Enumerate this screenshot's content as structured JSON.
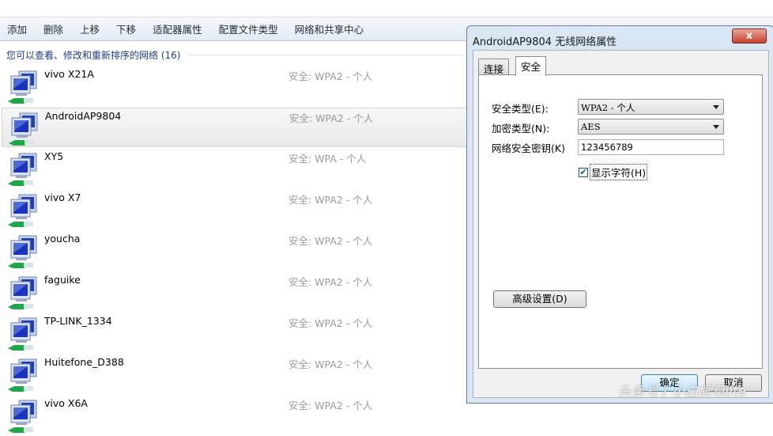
{
  "toolbar": {
    "items": [
      "添加",
      "删除",
      "上移",
      "下移",
      "适配器属性",
      "配置文件类型",
      "网络和共享中心"
    ]
  },
  "group_header": "您可以查看、修改和重新排序的网络 (16)",
  "networks": [
    {
      "name": "vivo X21A",
      "security": "安全: WPA2 - 个人"
    },
    {
      "name": "AndroidAP9804",
      "security": "安全: WPA2 - 个人",
      "selected": true
    },
    {
      "name": "XY5",
      "security": "安全: WPA - 个人"
    },
    {
      "name": "vivo X7",
      "security": "安全: WPA2 - 个人"
    },
    {
      "name": "youcha",
      "security": "安全: WPA2 - 个人"
    },
    {
      "name": "faguike",
      "security": "安全: WPA2 - 个人"
    },
    {
      "name": "TP-LINK_1334",
      "security": "安全: WPA2 - 个人"
    },
    {
      "name": "Huitefone_D388",
      "security": "安全: WPA2 - 个人"
    },
    {
      "name": "vivo X6A",
      "security": "安全: WPA2 - 个人"
    }
  ],
  "dialog": {
    "title": "AndroidAP9804 无线网络属性",
    "close": "x",
    "tabs": [
      "连接",
      "安全"
    ],
    "security_type_label": "安全类型(E):",
    "security_type_value": "WPA2 - 个人",
    "encryption_type_label": "加密类型(N):",
    "encryption_type_value": "AES",
    "key_label": "网络安全密钥(K)",
    "key_value": "123456789",
    "show_chars_label": "显示字符(H)",
    "show_chars_checked": true,
    "advanced_button": "高级设置(D)",
    "ok_button": "确定",
    "cancel_button": "取消"
  },
  "watermark": "头条号 / 小白牌草lite"
}
